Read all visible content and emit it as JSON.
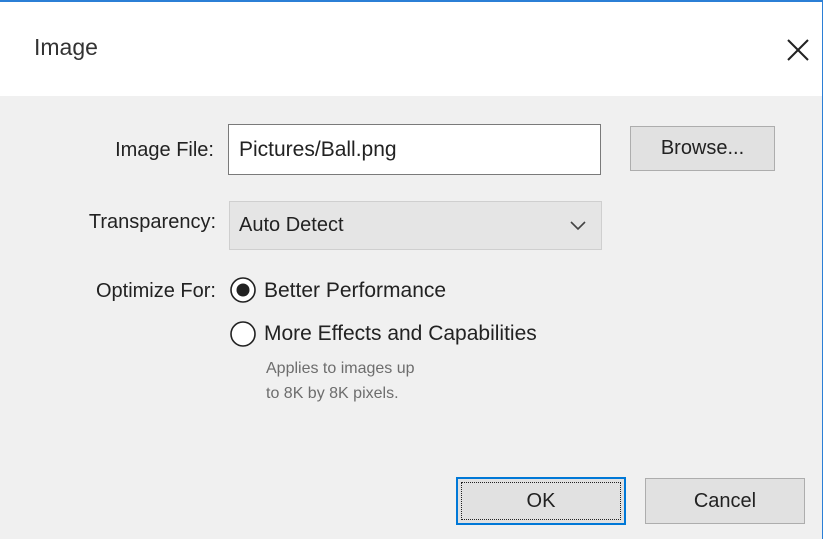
{
  "dialog": {
    "title": "Image"
  },
  "image_file": {
    "label": "Image File:",
    "value": "Pictures/Ball.png",
    "browse_label": "Browse..."
  },
  "transparency": {
    "label": "Transparency:",
    "selected": "Auto Detect"
  },
  "optimize": {
    "label": "Optimize For:",
    "options": [
      {
        "label": "Better Performance",
        "selected": true
      },
      {
        "label": "More Effects and Capabilities",
        "selected": false
      }
    ],
    "hint_line1": "Applies to images up",
    "hint_line2": "to 8K by 8K pixels."
  },
  "buttons": {
    "ok": "OK",
    "cancel": "Cancel"
  },
  "colors": {
    "accent": "#0078d7",
    "window_border": "#2b7fd6",
    "dialog_bg": "#f0f0f0",
    "hint_text": "#6d6d6d"
  },
  "icons": {
    "close": "close-icon",
    "dropdown": "chevron-down-icon"
  }
}
